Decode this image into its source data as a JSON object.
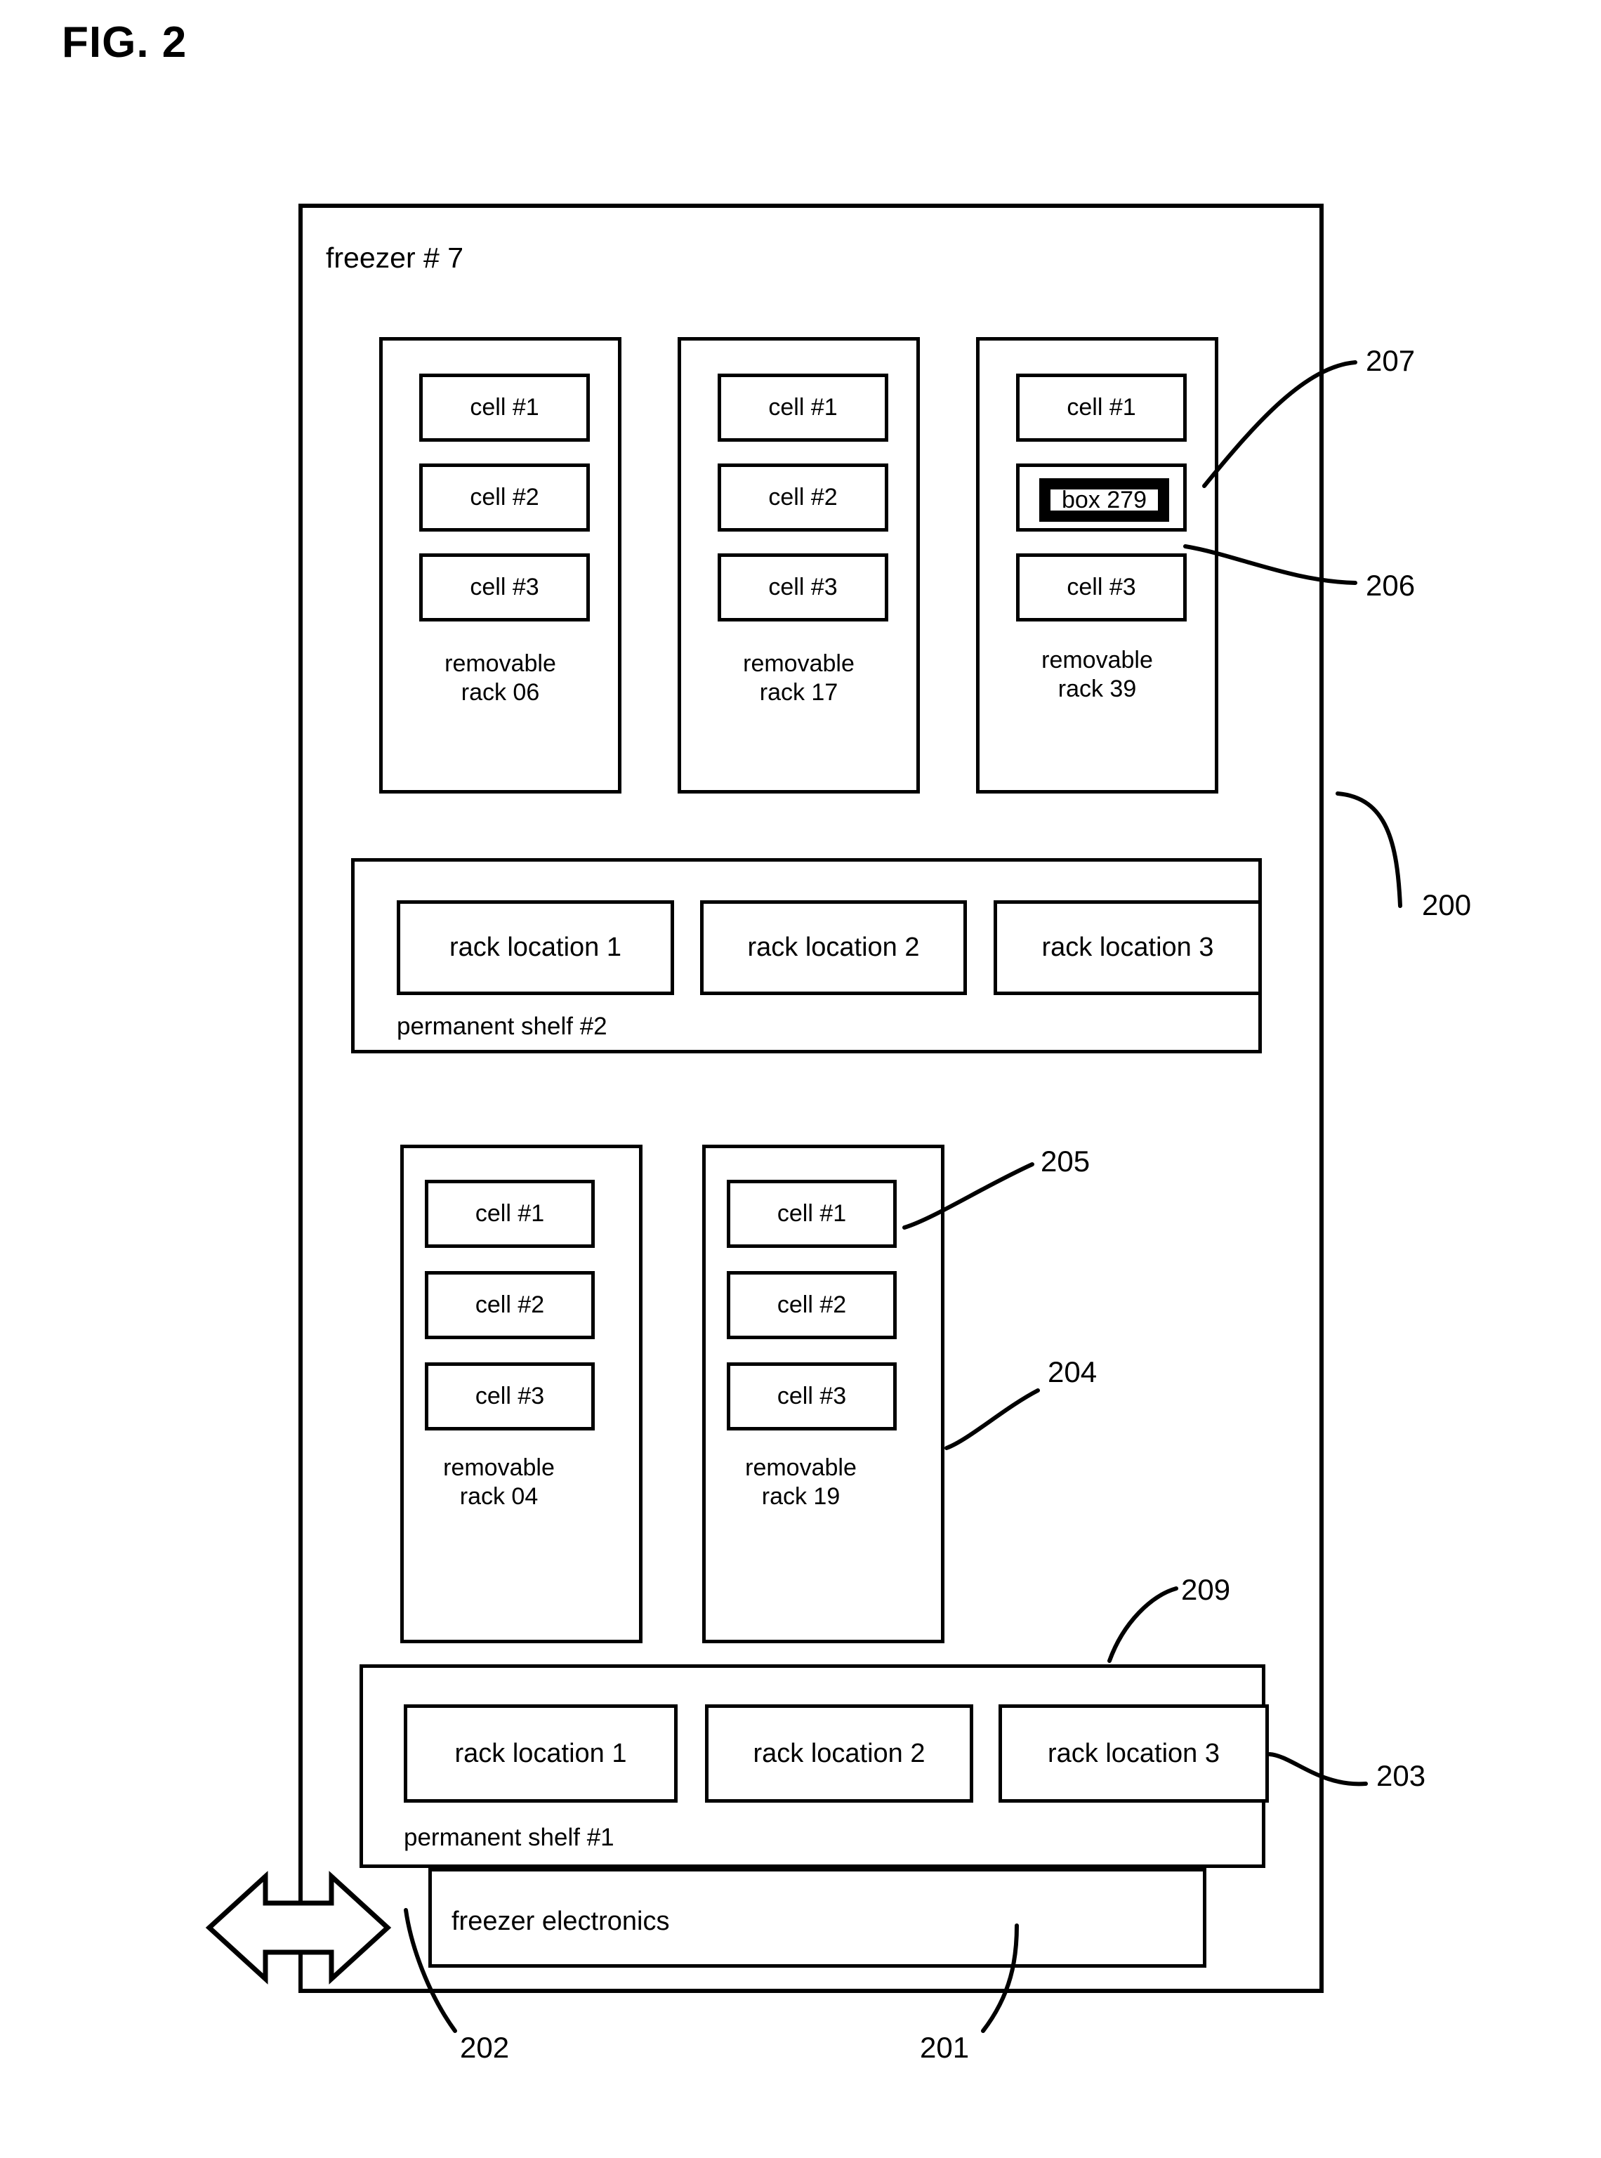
{
  "figure": {
    "title": "FIG. 2",
    "enclosure_label": "freezer # 7"
  },
  "racks": [
    {
      "id": "rack-06",
      "caption_line1": "removable",
      "caption_line2": "rack 06",
      "cells": [
        {
          "label": "cell #1"
        },
        {
          "label": "cell #2"
        },
        {
          "label": "cell #3"
        }
      ]
    },
    {
      "id": "rack-17",
      "caption_line1": "removable",
      "caption_line2": "rack 17",
      "cells": [
        {
          "label": "cell #1"
        },
        {
          "label": "cell #2"
        },
        {
          "label": "cell #3"
        }
      ]
    },
    {
      "id": "rack-39",
      "caption_line1": "removable",
      "caption_line2": "rack 39",
      "cells": [
        {
          "label": "cell #1"
        },
        {
          "label": "",
          "box_label": "box 279"
        },
        {
          "label": "cell #3"
        }
      ]
    },
    {
      "id": "rack-04",
      "caption_line1": "removable",
      "caption_line2": "rack 04",
      "cells": [
        {
          "label": "cell #1"
        },
        {
          "label": "cell #2"
        },
        {
          "label": "cell #3"
        }
      ]
    },
    {
      "id": "rack-19",
      "caption_line1": "removable",
      "caption_line2": "rack 19",
      "cells": [
        {
          "label": "cell #1"
        },
        {
          "label": "cell #2"
        },
        {
          "label": "cell #3"
        }
      ]
    }
  ],
  "shelves": [
    {
      "id": "shelf-2",
      "caption": "permanent shelf #2",
      "locations": [
        "rack location 1",
        "rack location 2",
        "rack location 3"
      ]
    },
    {
      "id": "shelf-1",
      "caption": "permanent shelf #1",
      "locations": [
        "rack location 1",
        "rack location 2",
        "rack location 3"
      ]
    }
  ],
  "electronics": {
    "label": "freezer electronics"
  },
  "reference_numerals": {
    "n200": "200",
    "n201": "201",
    "n202": "202",
    "n203": "203",
    "n204": "204",
    "n205": "205",
    "n206": "206",
    "n207": "207",
    "n209": "209"
  },
  "colors": {
    "ink": "#000000",
    "paper": "#ffffff"
  }
}
